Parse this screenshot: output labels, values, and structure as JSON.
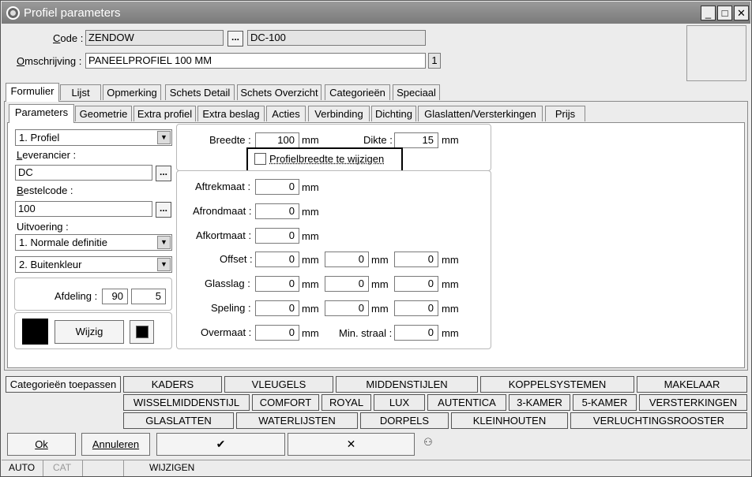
{
  "window": {
    "title": "Profiel parameters"
  },
  "header": {
    "code_label": "Code :",
    "code_value": "ZENDOW",
    "code_btn": "...",
    "code_extra": "DC-100",
    "omschrijving_label": "Omschrijving :",
    "omschrijving_value": "PANEELPROFIEL 100 MM",
    "omschrijving_num": "1"
  },
  "main_tabs": [
    "Formulier",
    "Lijst",
    "Opmerking",
    "Schets Detail",
    "Schets Overzicht",
    "Categorieën",
    "Speciaal"
  ],
  "sub_tabs": [
    "Parameters",
    "Geometrie",
    "Extra profiel",
    "Extra beslag",
    "Acties",
    "Verbinding",
    "Dichting",
    "Glaslatten/Versterkingen",
    "Prijs"
  ],
  "left": {
    "type_select": "1.  Profiel",
    "leverancier_label": "Leverancier :",
    "leverancier_value": "DC",
    "bestelcode_label": "Bestelcode :",
    "bestelcode_value": "100",
    "uitvoering_label": "Uitvoering :",
    "uitvoering_select": "1.  Normale definitie",
    "kleur_select": "2.  Buitenkleur",
    "afdeling_label": "Afdeling :",
    "afdeling_1": "90",
    "afdeling_2": "5",
    "wijzig_label": "Wijzig",
    "color_swatch": "#000000"
  },
  "params": {
    "breedte_label": "Breedte :",
    "breedte_value": "100",
    "dikte_label": "Dikte :",
    "dikte_value": "15",
    "unit": "mm",
    "checkbox_label": "Profielbreedte te wijzigen",
    "aftrek_label": "Aftrekmaat :",
    "aftrek_value": "0",
    "afrond_label": "Afrondmaat :",
    "afrond_value": "0",
    "afkort_label": "Afkortmaat :",
    "afkort_value": "0",
    "offset_label": "Offset :",
    "offset_values": [
      "0",
      "0",
      "0"
    ],
    "glasslag_label": "Glasslag :",
    "glasslag_values": [
      "0",
      "0",
      "0"
    ],
    "speling_label": "Speling :",
    "speling_values": [
      "0",
      "0",
      "0"
    ],
    "overmaat_label": "Overmaat :",
    "overmaat_value": "0",
    "minstraal_label": "Min. straal :",
    "minstraal_value": "0"
  },
  "categories": {
    "apply_label": "Categorieën toepassen",
    "row1": [
      "KADERS",
      "VLEUGELS",
      "MIDDENSTIJLEN",
      "KOPPELSYSTEMEN",
      "MAKELAAR"
    ],
    "row2": [
      "WISSELMIDDENSTIJL",
      "COMFORT",
      "ROYAL",
      "LUX",
      "AUTENTICA",
      "3-KAMER",
      "5-KAMER",
      "VERSTERKINGEN"
    ],
    "row3": [
      "GLASLATTEN",
      "WATERLIJSTEN",
      "DORPELS",
      "KLEINHOUTEN",
      "VERLUCHTINGSROOSTER"
    ]
  },
  "footer": {
    "ok": "Ok",
    "annuleren": "Annuleren",
    "check": "✔",
    "cross": "✕"
  },
  "statusbar": [
    "AUTO",
    "CAT",
    "",
    "WIJZIGEN"
  ]
}
